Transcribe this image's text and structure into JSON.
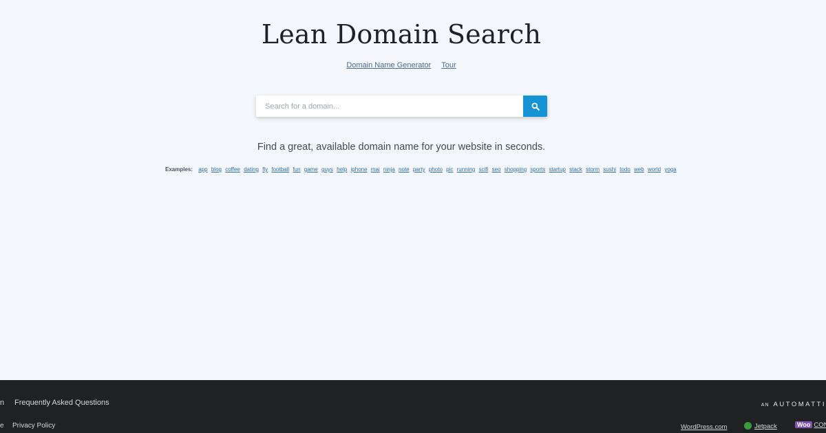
{
  "header": {
    "title": "Lean Domain Search",
    "nav": [
      {
        "label": "Domain Name Generator"
      },
      {
        "label": "Tour"
      }
    ]
  },
  "search": {
    "placeholder": "Search for a domain...",
    "value": "",
    "button_icon": "search-icon"
  },
  "tagline": "Find a great, available domain name for your website in seconds.",
  "examples": {
    "label": "Examples:",
    "items": [
      "app",
      "blog",
      "coffee",
      "dating",
      "fly",
      "football",
      "fun",
      "game",
      "guys",
      "help",
      "iphone",
      "mai",
      "ninja",
      "note",
      "party",
      "photo",
      "pic",
      "running",
      "scifi",
      "seo",
      "shopping",
      "sports",
      "startup",
      "stack",
      "storm",
      "sushi",
      "todo",
      "web",
      "world",
      "yoga"
    ]
  },
  "footer": {
    "links": [
      {
        "label": "n"
      },
      {
        "label": "Frequently Asked Questions"
      },
      {
        "label": "e"
      },
      {
        "label": "Privacy Policy"
      }
    ],
    "brand_prefix": "AN",
    "brand_name": "AUTOMATTI",
    "products": [
      {
        "label": "WordPress.com"
      },
      {
        "label": "Jetpack",
        "icon": "jetpack-icon"
      },
      {
        "label_box": "Woo",
        "label": "CON",
        "icon": "woocommerce-icon"
      }
    ]
  },
  "colors": {
    "background": "#f3f6fa",
    "accent": "#1593d4",
    "footer": "#202122"
  }
}
